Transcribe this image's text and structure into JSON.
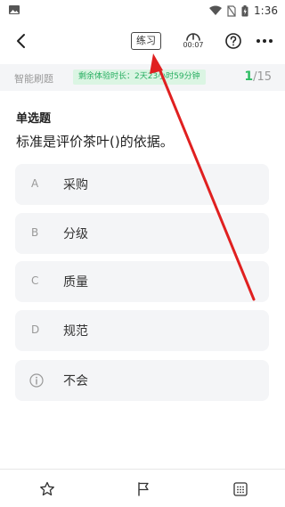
{
  "status_bar": {
    "time": "1:36"
  },
  "header": {
    "mode_label": "练习",
    "timer": "00:07"
  },
  "info_bar": {
    "label": "智能刷题",
    "trial_badge": "剩余体验时长：2天23小时59分钟",
    "current": "1",
    "total": "/15"
  },
  "question": {
    "type": "单选题",
    "text": "标准是评价茶叶()的依据。",
    "options": [
      {
        "letter": "A",
        "text": "采购"
      },
      {
        "letter": "B",
        "text": "分级"
      },
      {
        "letter": "C",
        "text": "质量"
      },
      {
        "letter": "D",
        "text": "规范"
      }
    ],
    "skip_label": "不会"
  },
  "colors": {
    "accent": "#2dbd63",
    "annotation_arrow": "#e02020"
  }
}
